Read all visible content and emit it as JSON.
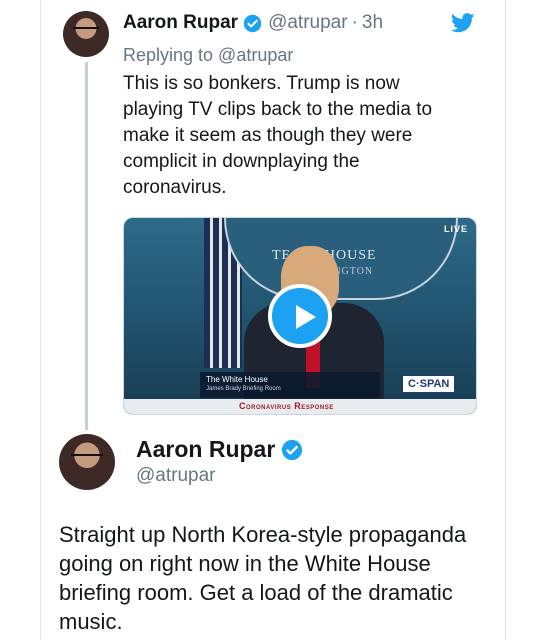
{
  "colors": {
    "twitter_blue": "#1da1f2",
    "text_primary": "#14171a",
    "text_secondary": "#657786",
    "thread_line": "#c4cfd6"
  },
  "quoted_tweet": {
    "author_name": "Aaron Rupar",
    "handle": "@atrupar",
    "separator": "·",
    "time": "3h",
    "replying_to": "Replying to @atrupar",
    "text": "This is so bonkers. Trump is now playing TV clips back to the media to make it seem as though they were complicit in downplaying the coronavirus.",
    "icons": [
      "verified-badge-icon",
      "twitter-bird-icon",
      "avatar"
    ],
    "video": {
      "live_badge": "LIVE",
      "sign_text": "TE  ITE HOUSE",
      "sign_subtext": "INGTON",
      "lower_third_title": "The White House",
      "lower_third_subtitle": "James Brady Briefing Room",
      "network": "C·SPAN",
      "banner": "Coronavirus Response",
      "play_icon": "play-icon"
    }
  },
  "main_tweet": {
    "author_name": "Aaron Rupar",
    "handle": "@atrupar",
    "text": "Straight up North Korea-style propaganda going on right now in the White House briefing room. Get a load of the dramatic music.",
    "icons": [
      "verified-badge-icon",
      "avatar"
    ]
  }
}
